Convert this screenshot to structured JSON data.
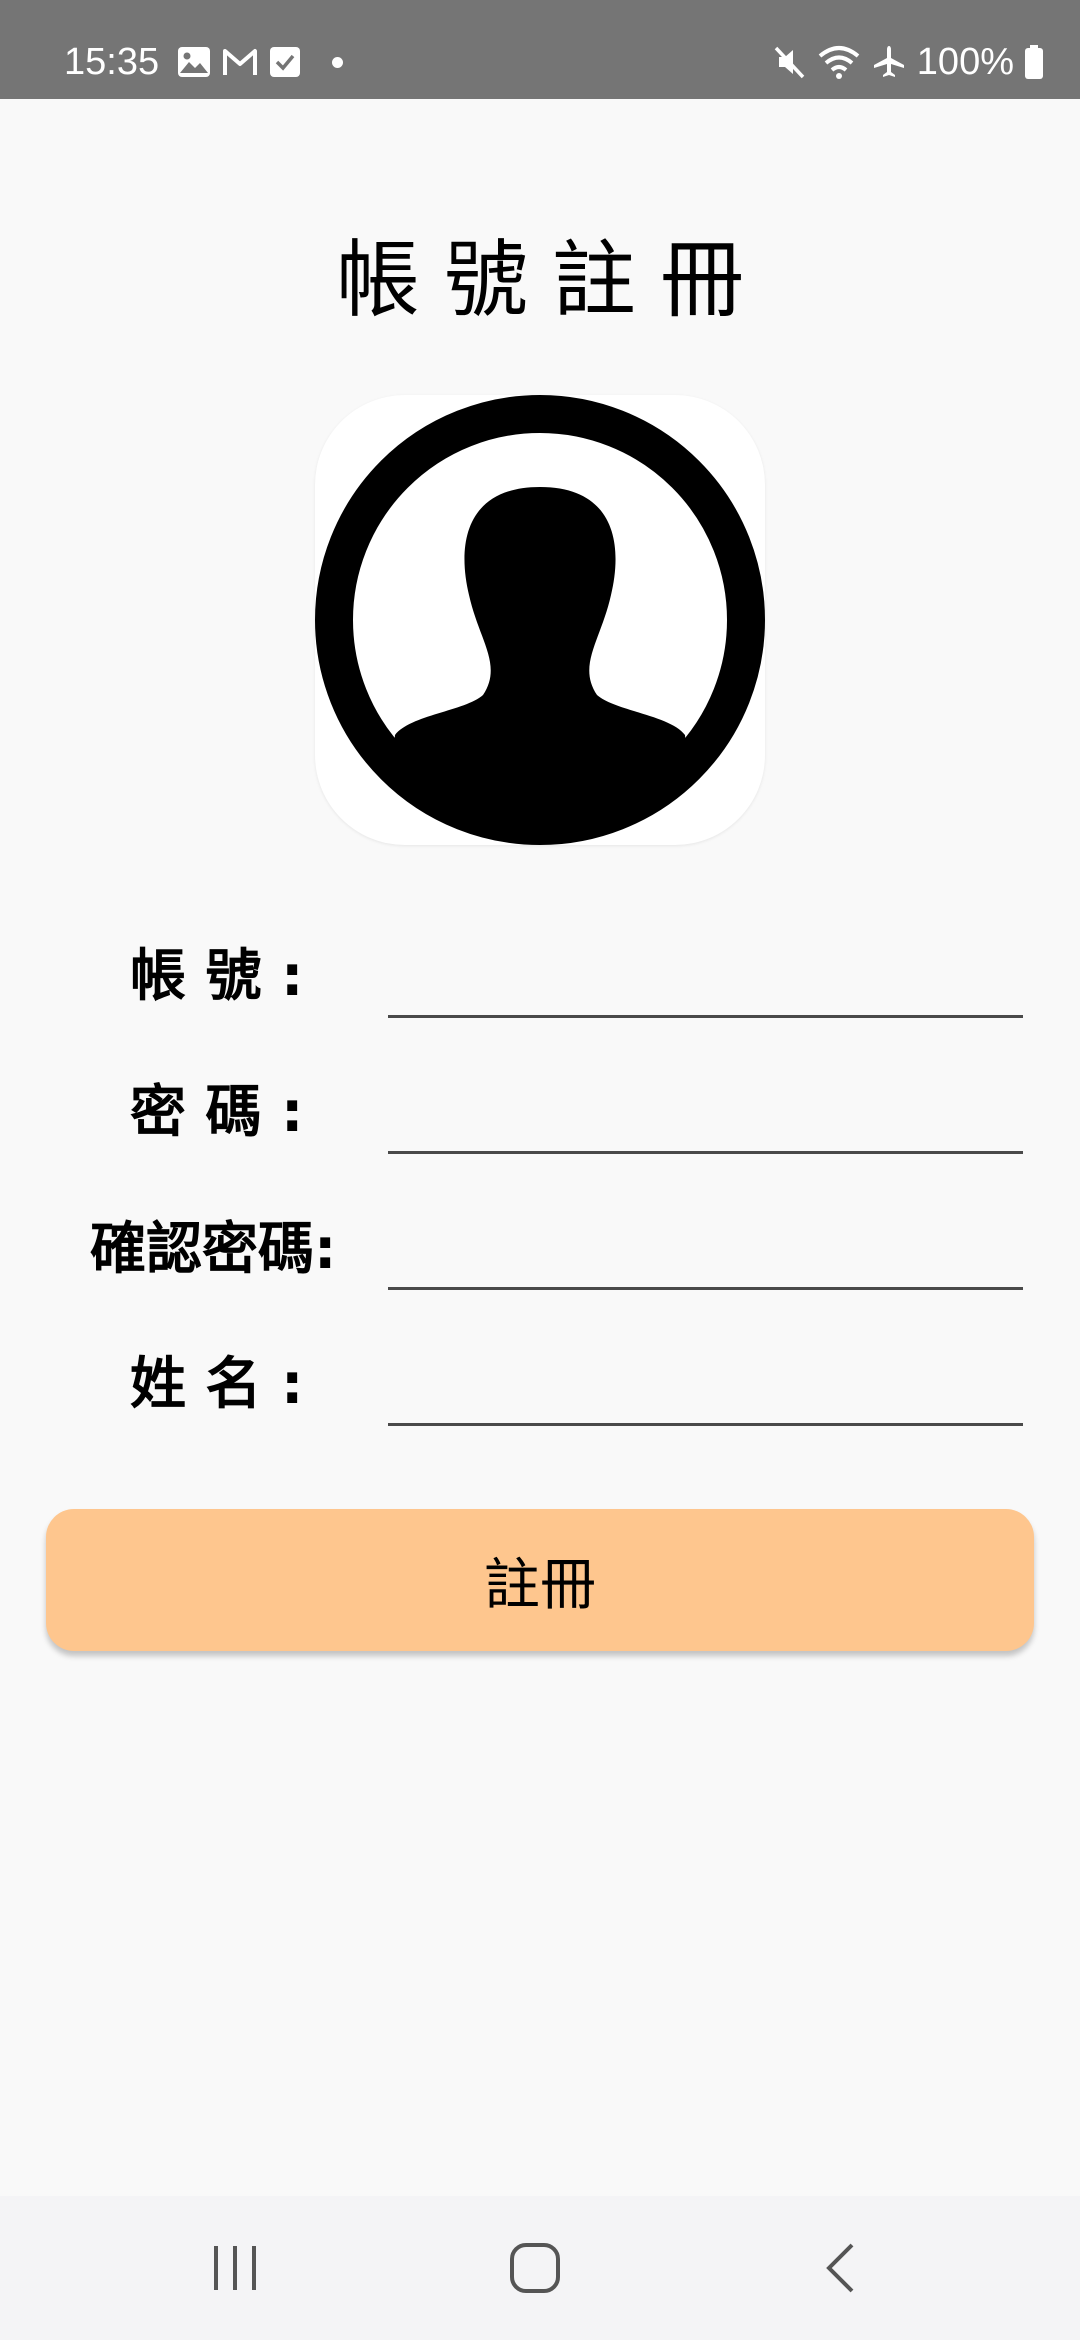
{
  "status_bar": {
    "time": "15:35",
    "battery": "100%",
    "icons_left": [
      "gallery-icon",
      "gmail-icon",
      "check-icon",
      "dot"
    ],
    "icons_right": [
      "mute-icon",
      "wifi-icon",
      "airplane-icon",
      "battery-icon"
    ]
  },
  "page": {
    "title": "帳號註冊"
  },
  "form": {
    "account_label": "帳 號 :",
    "password_label": "密 碼 :",
    "confirm_password_label": "確認密碼:",
    "name_label": "姓 名 :",
    "account_value": "",
    "password_value": "",
    "confirm_password_value": "",
    "name_value": ""
  },
  "register_button": {
    "label": "註冊",
    "color": "#fec68e"
  },
  "nav_bar": {
    "items": [
      "recent-apps-icon",
      "home-icon",
      "back-icon"
    ]
  }
}
